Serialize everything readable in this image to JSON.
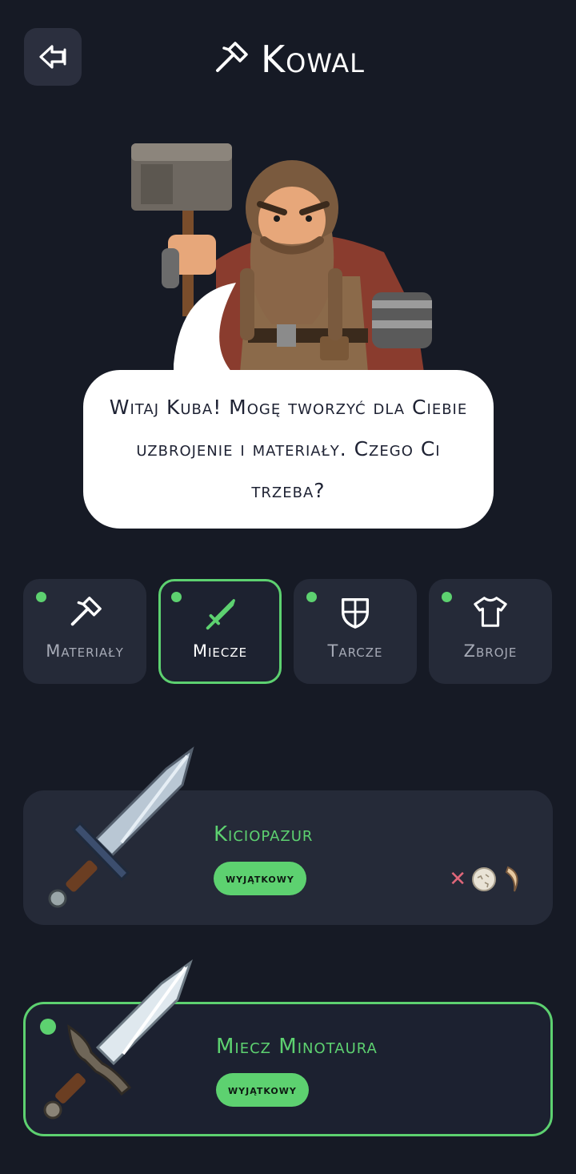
{
  "header": {
    "title": "Kowal",
    "back_icon": "back-arrow-icon",
    "title_icon": "hammer-icon"
  },
  "dialog": {
    "text": "Witaj Kuba! Mogę tworzyć dla Ciebie uzbrojenie i materiały. Czego Ci trzeba?"
  },
  "tabs": [
    {
      "label": "Materiały",
      "icon": "hammer-icon",
      "active": false
    },
    {
      "label": "Miecze",
      "icon": "sword-icon",
      "active": true
    },
    {
      "label": "Tarcze",
      "icon": "shield-icon",
      "active": false
    },
    {
      "label": "Zbroje",
      "icon": "shirt-icon",
      "active": false
    }
  ],
  "items": [
    {
      "name": "Kiciopazur",
      "rarity": "wyjątkowy",
      "requirements": [
        "missing-x-icon",
        "egg-icon",
        "claw-icon"
      ],
      "selected": false
    },
    {
      "name": "Miecz Minotaura",
      "rarity": "wyjątkowy",
      "selected": true
    }
  ],
  "colors": {
    "background": "#161a25",
    "card": "#252a38",
    "accent": "#5dd170",
    "missing": "#e0677a"
  }
}
